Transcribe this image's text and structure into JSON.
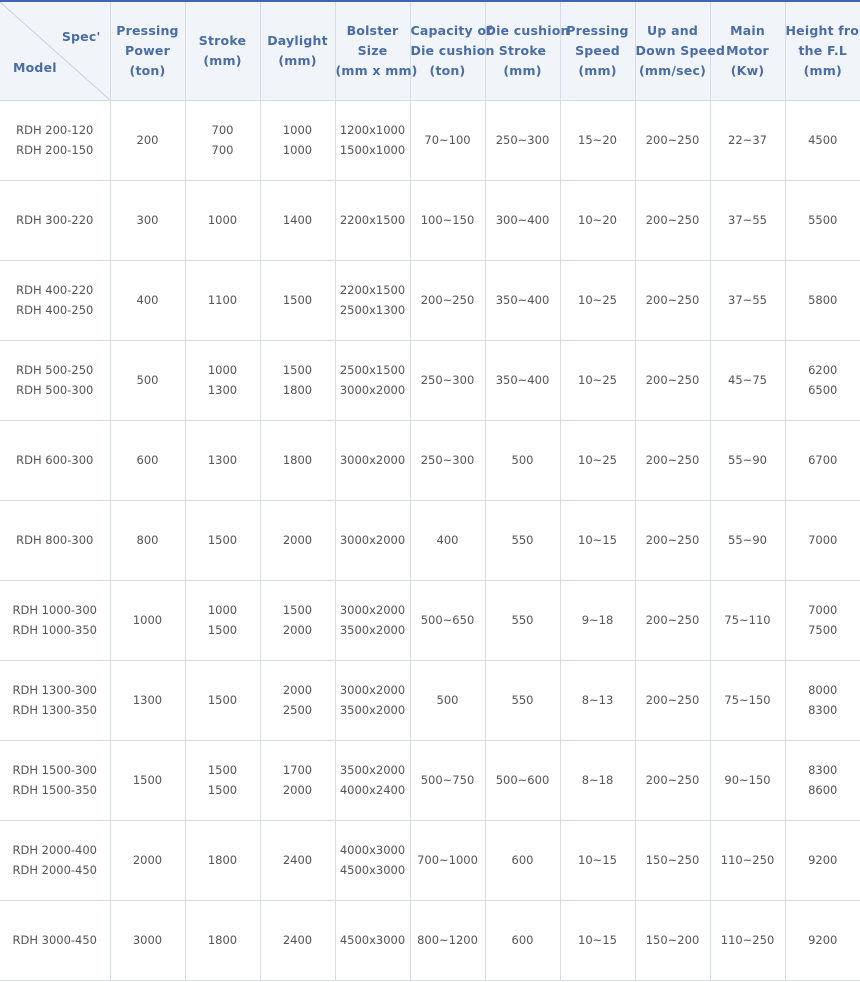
{
  "header": {
    "corner_top": "Spec'",
    "corner_bottom": "Model",
    "columns": [
      [
        "Pressing",
        "Power",
        "(ton)"
      ],
      [
        "Stroke",
        "(mm)"
      ],
      [
        "Daylight",
        "(mm)"
      ],
      [
        "Bolster",
        "Size",
        "(mm x mm)"
      ],
      [
        "Capacity of",
        "Die cushion",
        "(ton)"
      ],
      [
        "Die cushion",
        "Stroke",
        "(mm)"
      ],
      [
        "Pressing",
        "Speed",
        "(mm)"
      ],
      [
        "Up and",
        "Down Speed",
        "(mm/sec)"
      ],
      [
        "Main",
        "Motor",
        "(Kw)"
      ],
      [
        "Height from",
        "the F.L",
        "(mm)"
      ]
    ]
  },
  "rows": [
    [
      [
        "RDH 200-120",
        "RDH 200-150"
      ],
      [
        "200"
      ],
      [
        "700",
        "700"
      ],
      [
        "1000",
        "1000"
      ],
      [
        "1200x1000",
        "1500x1000"
      ],
      [
        "70~100"
      ],
      [
        "250~300"
      ],
      [
        "15~20"
      ],
      [
        "200~250"
      ],
      [
        "22~37"
      ],
      [
        "4500"
      ]
    ],
    [
      [
        "RDH 300-220"
      ],
      [
        "300"
      ],
      [
        "1000"
      ],
      [
        "1400"
      ],
      [
        "2200x1500"
      ],
      [
        "100~150"
      ],
      [
        "300~400"
      ],
      [
        "10~20"
      ],
      [
        "200~250"
      ],
      [
        "37~55"
      ],
      [
        "5500"
      ]
    ],
    [
      [
        "RDH 400-220",
        "RDH 400-250"
      ],
      [
        "400"
      ],
      [
        "1100"
      ],
      [
        "1500"
      ],
      [
        "2200x1500",
        "2500x1300"
      ],
      [
        "200~250"
      ],
      [
        "350~400"
      ],
      [
        "10~25"
      ],
      [
        "200~250"
      ],
      [
        "37~55"
      ],
      [
        "5800"
      ]
    ],
    [
      [
        "RDH 500-250",
        "RDH 500-300"
      ],
      [
        "500"
      ],
      [
        "1000",
        "1300"
      ],
      [
        "1500",
        "1800"
      ],
      [
        "2500x1500",
        "3000x2000"
      ],
      [
        "250~300"
      ],
      [
        "350~400"
      ],
      [
        "10~25"
      ],
      [
        "200~250"
      ],
      [
        "45~75"
      ],
      [
        "6200",
        "6500"
      ]
    ],
    [
      [
        "RDH 600-300"
      ],
      [
        "600"
      ],
      [
        "1300"
      ],
      [
        "1800"
      ],
      [
        "3000x2000"
      ],
      [
        "250~300"
      ],
      [
        "500"
      ],
      [
        "10~25"
      ],
      [
        "200~250"
      ],
      [
        "55~90"
      ],
      [
        "6700"
      ]
    ],
    [
      [
        "RDH 800-300"
      ],
      [
        "800"
      ],
      [
        "1500"
      ],
      [
        "2000"
      ],
      [
        "3000x2000"
      ],
      [
        "400"
      ],
      [
        "550"
      ],
      [
        "10~15"
      ],
      [
        "200~250"
      ],
      [
        "55~90"
      ],
      [
        "7000"
      ]
    ],
    [
      [
        "RDH 1000-300",
        "RDH 1000-350"
      ],
      [
        "1000"
      ],
      [
        "1000",
        "1500"
      ],
      [
        "1500",
        "2000"
      ],
      [
        "3000x2000",
        "3500x2000"
      ],
      [
        "500~650"
      ],
      [
        "550"
      ],
      [
        "9~18"
      ],
      [
        "200~250"
      ],
      [
        "75~110"
      ],
      [
        "7000",
        "7500"
      ]
    ],
    [
      [
        "RDH 1300-300",
        "RDH 1300-350"
      ],
      [
        "1300"
      ],
      [
        "1500"
      ],
      [
        "2000",
        "2500"
      ],
      [
        "3000x2000",
        "3500x2000"
      ],
      [
        "500"
      ],
      [
        "550"
      ],
      [
        "8~13"
      ],
      [
        "200~250"
      ],
      [
        "75~150"
      ],
      [
        "8000",
        "8300"
      ]
    ],
    [
      [
        "RDH 1500-300",
        "RDH 1500-350"
      ],
      [
        "1500"
      ],
      [
        "1500",
        "1500"
      ],
      [
        "1700",
        "2000"
      ],
      [
        "3500x2000",
        "4000x2400"
      ],
      [
        "500~750"
      ],
      [
        "500~600"
      ],
      [
        "8~18"
      ],
      [
        "200~250"
      ],
      [
        "90~150"
      ],
      [
        "8300",
        "8600"
      ]
    ],
    [
      [
        "RDH 2000-400",
        "RDH 2000-450"
      ],
      [
        "2000"
      ],
      [
        "1800"
      ],
      [
        "2400"
      ],
      [
        "4000x3000",
        "4500x3000"
      ],
      [
        "700~1000"
      ],
      [
        "600"
      ],
      [
        "10~15"
      ],
      [
        "150~250"
      ],
      [
        "110~250"
      ],
      [
        "9200"
      ]
    ],
    [
      [
        "RDH 3000-450"
      ],
      [
        "3000"
      ],
      [
        "1800"
      ],
      [
        "2400"
      ],
      [
        "4500x3000"
      ],
      [
        "800~1200"
      ],
      [
        "600"
      ],
      [
        "10~15"
      ],
      [
        "150~200"
      ],
      [
        "110~250"
      ],
      [
        "9200"
      ]
    ]
  ],
  "colors": {
    "accent": "#3e67b0",
    "header_text": "#4a6da8",
    "header_bg": "#f1f4f9",
    "grid": "#d7dde6",
    "cell_text": "#555555"
  }
}
